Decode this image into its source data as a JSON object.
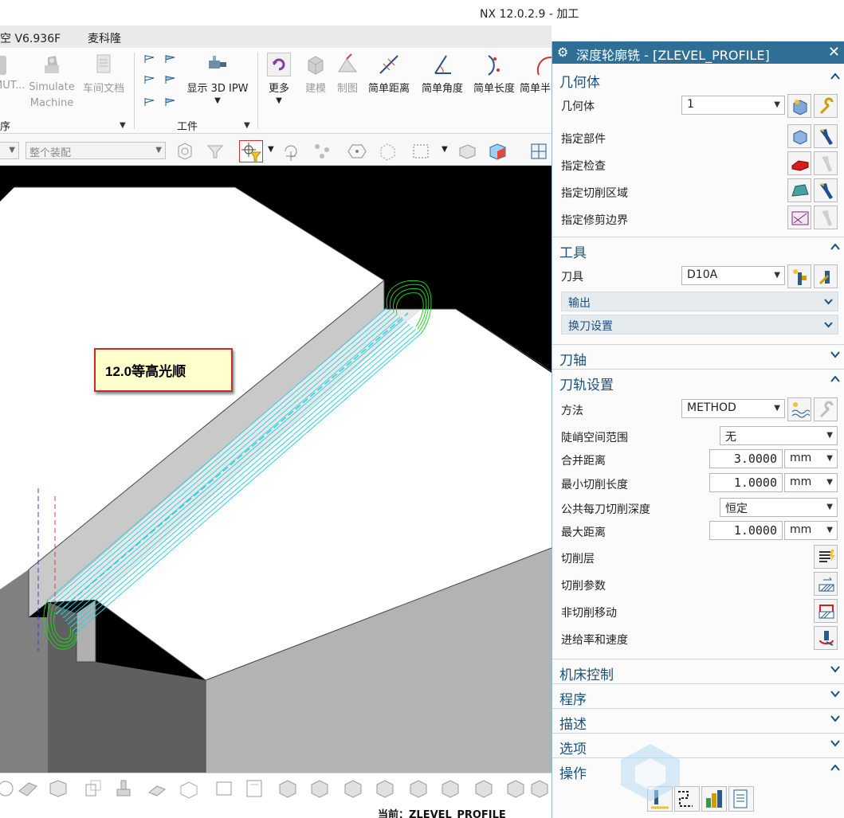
{
  "window": {
    "title": "NX 12.0.2.9 - 加工"
  },
  "menubar": {
    "items": [
      "空 V6.936F",
      "麦科隆"
    ]
  },
  "ribbon": {
    "buttons": {
      "mut": "MUT...",
      "simulate": "Simulate Machine",
      "shop_doc": "车间文档",
      "show_ipw": "显示 3D IPW",
      "more": "更多",
      "build": "建模",
      "drafting": "制图",
      "simple_distance": "简单距离",
      "simple_angle": "简单角度",
      "simple_length": "简单长度",
      "simple_radius": "简单半"
    },
    "groups": {
      "left": "序",
      "workpiece": "工件"
    }
  },
  "toolbar2": {
    "assembly_combo": "整个装配"
  },
  "viewport": {
    "callout": "12.0等高光顺"
  },
  "statusbar": {
    "current": "当前：ZLEVEL_PROFILE"
  },
  "dialog": {
    "title": "深度轮廓铣 - [ZLEVEL_PROFILE]",
    "sections": {
      "geometry": {
        "header": "几何体",
        "geometry_label": "几何体",
        "geometry_value": "1",
        "specify_part": "指定部件",
        "specify_check": "指定检查",
        "specify_cut_area": "指定切削区域",
        "specify_trim": "指定修剪边界"
      },
      "tool": {
        "header": "工具",
        "tool_label": "刀具",
        "tool_value": "D10A",
        "output": "输出",
        "tool_change": "换刀设置"
      },
      "axis": {
        "header": "刀轴"
      },
      "path": {
        "header": "刀轨设置",
        "method_label": "方法",
        "method_value": "METHOD",
        "steep_label": "陡峭空间范围",
        "steep_value": "无",
        "merge_label": "合并距离",
        "merge_value": "3.0000",
        "merge_unit": "mm",
        "min_cut_label": "最小切削长度",
        "min_cut_value": "1.0000",
        "min_cut_unit": "mm",
        "depth_label": "公共每刀切削深度",
        "depth_value": "恒定",
        "max_dist_label": "最大距离",
        "max_dist_value": "1.0000",
        "max_dist_unit": "mm",
        "cut_levels": "切削层",
        "cut_params": "切削参数",
        "non_cut": "非切削移动",
        "feeds": "进给率和速度"
      },
      "machine": {
        "header": "机床控制"
      },
      "program": {
        "header": "程序"
      },
      "description": {
        "header": "描述"
      },
      "options": {
        "header": "选项"
      },
      "actions": {
        "header": "操作"
      }
    }
  },
  "colors": {
    "dialog_title": "#2f6f96",
    "section_header": "#1b4f7a",
    "toolpath_cyan": "#2ecfe0",
    "toolpath_green": "#1fd21f",
    "callout_border": "#cc2a2a"
  }
}
